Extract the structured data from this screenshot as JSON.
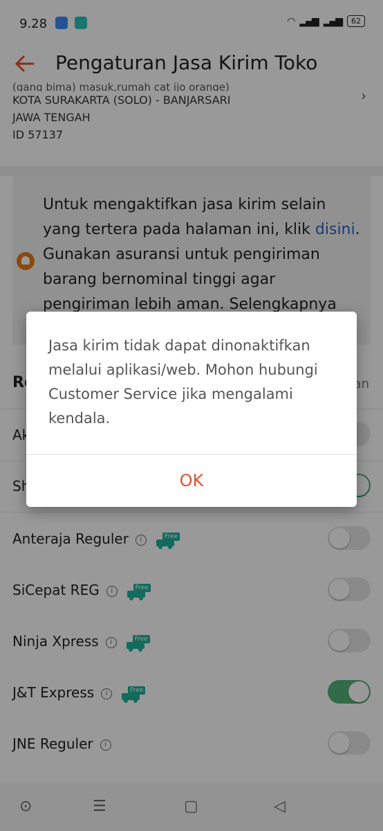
{
  "status_bar": {
    "time": "9.28",
    "battery": "62"
  },
  "app_bar": {
    "title": "Pengaturan Jasa Kirim Toko"
  },
  "address": {
    "clipped_line": "(gang bima) masuk,rumah cat ijo orange)",
    "line1": "KOTA SURAKARTA (SOLO) - BANJARSARI",
    "line2": "JAWA TENGAH",
    "line3": "ID 57137"
  },
  "info_card": {
    "text_before_link": "Untuk mengaktifkan jasa kirim selain yang tertera pada halaman ini, klik ",
    "link_text": "disini",
    "text_after_link": ".  Gunakan asuransi untuk pengiriman barang bernominal tinggi agar pengiriman lebih aman. Selengkapnya"
  },
  "section": {
    "head_partial": "Re",
    "head_right_partial": "an"
  },
  "couriers": [
    {
      "label": "Ak",
      "info": false,
      "free": false,
      "on": false
    },
    {
      "label": "Sh",
      "info": false,
      "free": false,
      "on": true
    },
    {
      "label": "Anteraja Reguler",
      "info": true,
      "free": true,
      "on": false
    },
    {
      "label": "SiCepat REG",
      "info": true,
      "free": true,
      "on": false
    },
    {
      "label": "Ninja Xpress",
      "info": true,
      "free": true,
      "on": false
    },
    {
      "label": "J&T Express",
      "info": true,
      "free": true,
      "on": true
    },
    {
      "label": "JNE Reguler",
      "info": true,
      "free": false,
      "on": false
    }
  ],
  "badge": {
    "free_text": "Free"
  },
  "dialog": {
    "message": "Jasa kirim tidak dapat dinonaktifkan melalui aplikasi/web. Mohon hubungi Customer Service jika mengalami kendala.",
    "ok_label": "OK"
  },
  "colors": {
    "accent": "#e0522a",
    "toggle_on": "#53b37a",
    "link": "#2f5fbf",
    "badge": "#1fb39a"
  }
}
